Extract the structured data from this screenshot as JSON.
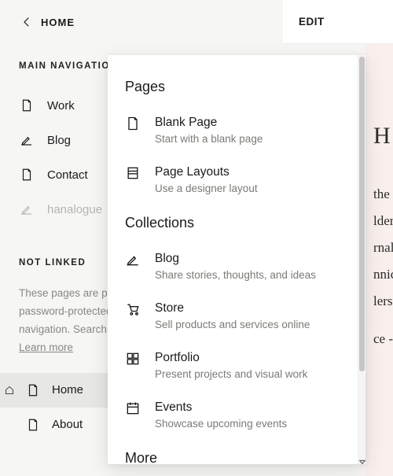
{
  "back_label": "HOME",
  "edit_label": "EDIT",
  "main_nav": {
    "heading": "MAIN NAVIGATION",
    "items": [
      {
        "label": "Work",
        "icon": "page-icon"
      },
      {
        "label": "Blog",
        "icon": "pen-icon"
      },
      {
        "label": "Contact",
        "icon": "page-icon"
      },
      {
        "label": "hanalogue",
        "icon": "pen-icon",
        "disabled": true
      }
    ]
  },
  "not_linked": {
    "heading": "NOT LINKED",
    "description": "These pages are public unless they're disabled or password-protected, but they don't appear in the navigation. Search engines can also discover them.",
    "learn_more": "Learn more",
    "items": [
      {
        "label": "Home",
        "icon": "page-icon",
        "active": true,
        "is_home": true
      },
      {
        "label": "About",
        "icon": "page-icon"
      }
    ]
  },
  "popover": {
    "sections": [
      {
        "heading": "Pages",
        "items": [
          {
            "title": "Blank Page",
            "desc": "Start with a blank page",
            "icon": "page-icon"
          },
          {
            "title": "Page Layouts",
            "desc": "Use a designer layout",
            "icon": "layout-icon"
          }
        ]
      },
      {
        "heading": "Collections",
        "items": [
          {
            "title": "Blog",
            "desc": "Share stories, thoughts, and ideas",
            "icon": "pen-icon"
          },
          {
            "title": "Store",
            "desc": "Sell products and services online",
            "icon": "cart-icon"
          },
          {
            "title": "Portfolio",
            "desc": "Present projects and visual work",
            "icon": "grid-icon"
          },
          {
            "title": "Events",
            "desc": "Showcase upcoming events",
            "icon": "calendar-icon"
          }
        ]
      },
      {
        "heading": "More",
        "items": []
      }
    ]
  },
  "preview": {
    "big": "H",
    "lines": [
      "the",
      "lder",
      "rnal",
      "nnic",
      "lers",
      "ce -"
    ]
  }
}
